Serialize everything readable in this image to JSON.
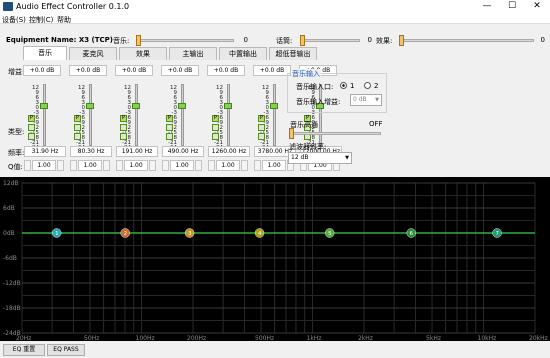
{
  "window": {
    "title": "Audio Effect Controller 0.1.0",
    "minimize": "—",
    "maximize": "☐",
    "close": "✕"
  },
  "menu": [
    "设备(S)",
    "控制(C)",
    "帮助"
  ],
  "equipment": {
    "label": "Equipment Name: X3 (TCP)"
  },
  "sliders": [
    {
      "label": "音乐:",
      "value": "0",
      "level": 0.0
    },
    {
      "label": "话筒:",
      "value": "0",
      "level": 0.0
    },
    {
      "label": "效果:",
      "value": "0",
      "level": 0.0
    }
  ],
  "tabs": [
    "音乐",
    "麦克风",
    "效果",
    "主输出",
    "中置输出",
    "超低音输出"
  ],
  "eq": {
    "gain_label": "增益:",
    "type_label": "类型:",
    "freq_label": "频率:",
    "q_label": "Q值:",
    "scale": [
      "12",
      "9",
      "6",
      "3",
      "0",
      "-3",
      "-6",
      "-9",
      "-12",
      "-15",
      "-18",
      "-21",
      "-24"
    ],
    "bands": [
      {
        "gain": "+0.0 dB",
        "freq": "31.90 Hz",
        "q": "1.00",
        "badge": "P",
        "level": 0.333
      },
      {
        "gain": "+0.0 dB",
        "freq": "80.30 Hz",
        "q": "1.00",
        "badge": "P",
        "level": 0.333
      },
      {
        "gain": "+0.0 dB",
        "freq": "191.00 Hz",
        "q": "1.00",
        "badge": "P",
        "level": 0.333
      },
      {
        "gain": "+0.0 dB",
        "freq": "490.00 Hz",
        "q": "1.00",
        "badge": "P",
        "level": 0.333
      },
      {
        "gain": "+0.0 dB",
        "freq": "1260.00 Hz",
        "q": "1.00",
        "badge": "P",
        "level": 0.333
      },
      {
        "gain": "+0.0 dB",
        "freq": "3780.00 Hz",
        "q": "1.00",
        "badge": "P",
        "level": 0.333
      },
      {
        "gain": "+0.0 dB",
        "freq": "12000.00 Hz",
        "q": "1.00",
        "badge": "P",
        "level": 0.333
      }
    ]
  },
  "music_input": {
    "group_title": "音乐输入",
    "port_label": "音乐输入口:",
    "port_options": [
      "1",
      "2"
    ],
    "gain_label": "音乐输入增益:",
    "gain_value": "0 dB",
    "hpf_label": "音乐高通",
    "hpf_value": "OFF",
    "slope_label": "滤波器斜率:",
    "slope_value": "12 dB"
  },
  "chart_data": {
    "type": "line",
    "ylabels": [
      "12dB",
      "6dB",
      "0dB",
      "-6dB",
      "-12dB",
      "-18dB",
      "-24dB"
    ],
    "xlabels": [
      "20Hz",
      "50Hz",
      "100Hz",
      "200Hz",
      "500Hz",
      "1kHz",
      "2kHz",
      "5kHz",
      "10kHz",
      "20kHz"
    ],
    "ylim": [
      -24,
      12
    ],
    "series": [
      {
        "x": [
          20,
          20000
        ],
        "values": [
          0,
          0
        ]
      }
    ],
    "nodes": [
      {
        "label": "1",
        "freq": 31.9,
        "gain": 0,
        "color": "#2bb7c9"
      },
      {
        "label": "2",
        "freq": 80.3,
        "gain": 0,
        "color": "#e0742a"
      },
      {
        "label": "3",
        "freq": 191,
        "gain": 0,
        "color": "#d9a21b"
      },
      {
        "label": "4",
        "freq": 490,
        "gain": 0,
        "color": "#b8b215"
      },
      {
        "label": "5",
        "freq": 1260,
        "gain": 0,
        "color": "#5db83d"
      },
      {
        "label": "6",
        "freq": 3780,
        "gain": 0,
        "color": "#2c9a3b"
      },
      {
        "label": "7",
        "freq": 12000,
        "gain": 0,
        "color": "#23a57f"
      }
    ],
    "grid": true,
    "line_color": "#36d24a"
  },
  "bottom": {
    "eq_reset": "EQ 重置",
    "eq_pass": "EQ PASS"
  }
}
